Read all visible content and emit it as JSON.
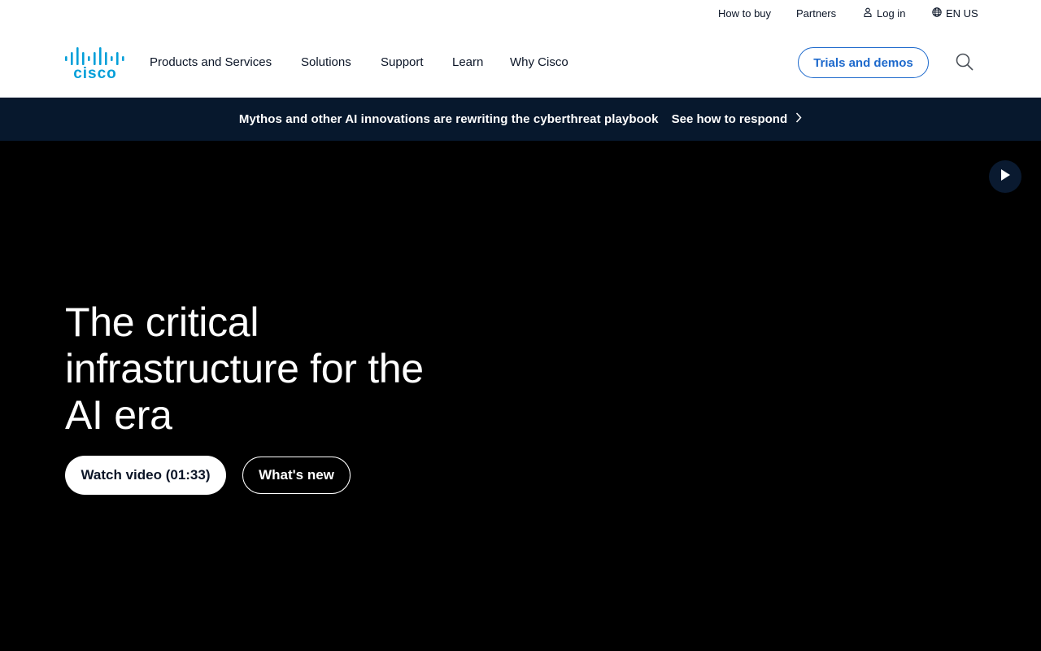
{
  "utility": {
    "how_to_buy": "How to buy",
    "partners": "Partners",
    "log_in": "Log in",
    "locale": "EN US"
  },
  "nav": {
    "logo_text": "cisco",
    "items": [
      "Products and Services",
      "Solutions",
      "Support",
      "Learn",
      "Why Cisco"
    ],
    "cta": "Trials and demos"
  },
  "banner": {
    "text": "Mythos and other AI innovations are rewriting the cyberthreat playbook",
    "link": "See how to respond"
  },
  "hero": {
    "title": "The critical infrastructure for the AI era",
    "primary_button": "Watch video (01:33)",
    "secondary_button": "What's new"
  },
  "colors": {
    "brand": "#049fd9",
    "accent": "#1d69cc",
    "banner_bg": "#07182d",
    "hero_bg": "#000000"
  },
  "icons": [
    "user-icon",
    "globe-icon",
    "search-icon",
    "chevron-right-icon",
    "play-icon"
  ]
}
